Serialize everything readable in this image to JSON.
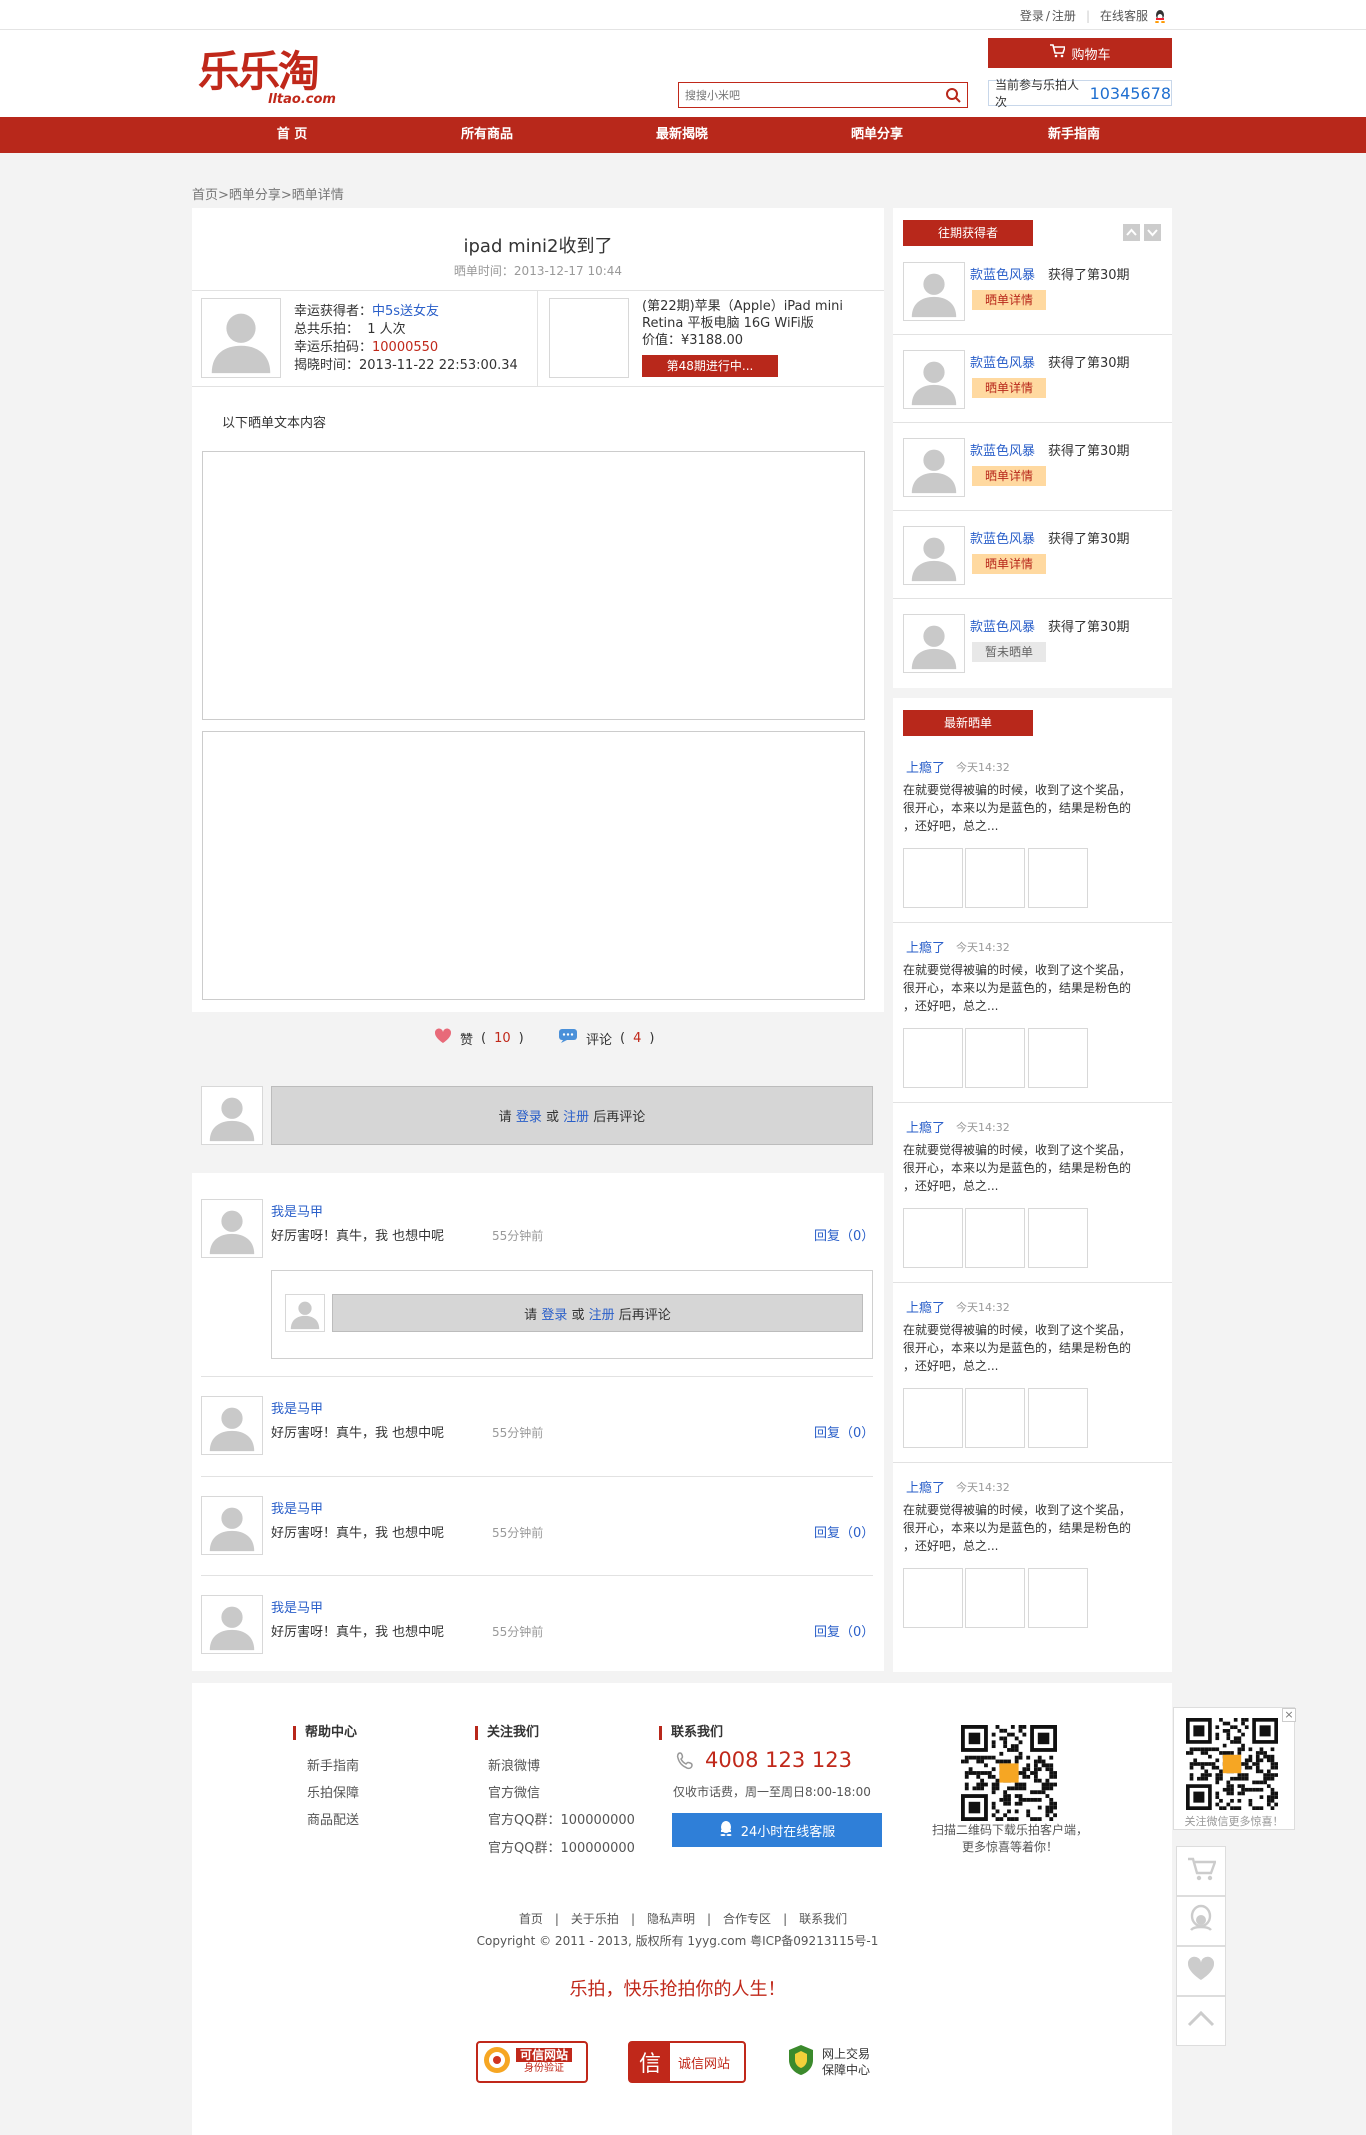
{
  "topbar": {
    "login": "登录",
    "sep": "/",
    "register": "注册",
    "service": "在线客服"
  },
  "header": {
    "logo_cn": "乐乐淘",
    "logo_en": "lltao.com",
    "search_placeholder": "搜搜小米吧",
    "cart_label": "购物车",
    "counter_label": "当前参与乐拍人次",
    "counter_value": "10345678"
  },
  "nav": [
    "首 页",
    "所有商品",
    "最新揭晓",
    "晒单分享",
    "新手指南"
  ],
  "breadcrumb": "首页>晒单分享>晒单详情",
  "post": {
    "title": "ipad mini2收到了",
    "time": "晒单时间：2013-12-17 10:44",
    "winner_label": "幸运获得者：",
    "winner_name": "中5s送女友",
    "total_label": "总共乐拍：",
    "total_value": "1 人次",
    "code_label": "幸运乐拍码：",
    "code_value": "10000550",
    "reveal_label": "揭晓时间：",
    "reveal_value": "2013-11-22 22:53:00.34",
    "product_line1": "(第22期)苹果（Apple）iPad mini",
    "product_line2": "Retina 平板电脑 16G WiFi版",
    "price_label": "价值：",
    "price_value": "¥3188.00",
    "progress_btn": "第48期进行中...",
    "body_text": "以下晒单文本内容",
    "like_label": "赞",
    "like_count": "10",
    "comment_label": "评论",
    "comment_count": "4"
  },
  "comment_prompt": {
    "pre": "请",
    "login": "登录",
    "or": "或",
    "register": "注册",
    "post": "后再评论"
  },
  "comments": [
    {
      "name": "我是马甲",
      "text": "好厉害呀！真牛，我 也想中呢",
      "time": "55分钟前",
      "reply": "回复（0）"
    },
    {
      "name": "我是马甲",
      "text": "好厉害呀！真牛，我 也想中呢",
      "time": "55分钟前",
      "reply": "回复（0）"
    },
    {
      "name": "我是马甲",
      "text": "好厉害呀！真牛，我 也想中呢",
      "time": "55分钟前",
      "reply": "回复（0）"
    },
    {
      "name": "我是马甲",
      "text": "好厉害呀！真牛，我 也想中呢",
      "time": "55分钟前",
      "reply": "回复（0）"
    }
  ],
  "past_winners": {
    "title": "往期获得者",
    "items": [
      {
        "name": "款蓝色风暴",
        "text": "获得了第30期",
        "btn": "晒单详情"
      },
      {
        "name": "款蓝色风暴",
        "text": "获得了第30期",
        "btn": "晒单详情"
      },
      {
        "name": "款蓝色风暴",
        "text": "获得了第30期",
        "btn": "晒单详情"
      },
      {
        "name": "款蓝色风暴",
        "text": "获得了第30期",
        "btn": "晒单详情"
      },
      {
        "name": "款蓝色风暴",
        "text": "获得了第30期",
        "btn": "暂未晒单"
      }
    ]
  },
  "latest_shares": {
    "title": "最新晒单",
    "items": [
      {
        "name": "上瘾了",
        "time": "今天14:32",
        "l1": "在就要觉得被骗的时候，收到了这个奖品，",
        "l2": "很开心，本来以为是蓝色的，结果是粉色的",
        "l3": "，还好吧，总之..."
      },
      {
        "name": "上瘾了",
        "time": "今天14:32",
        "l1": "在就要觉得被骗的时候，收到了这个奖品，",
        "l2": "很开心，本来以为是蓝色的，结果是粉色的",
        "l3": "，还好吧，总之..."
      },
      {
        "name": "上瘾了",
        "time": "今天14:32",
        "l1": "在就要觉得被骗的时候，收到了这个奖品，",
        "l2": "很开心，本来以为是蓝色的，结果是粉色的",
        "l3": "，还好吧，总之..."
      },
      {
        "name": "上瘾了",
        "time": "今天14:32",
        "l1": "在就要觉得被骗的时候，收到了这个奖品，",
        "l2": "很开心，本来以为是蓝色的，结果是粉色的",
        "l3": "，还好吧，总之..."
      },
      {
        "name": "上瘾了",
        "time": "今天14:32",
        "l1": "在就要觉得被骗的时候，收到了这个奖品，",
        "l2": "很开心，本来以为是蓝色的，结果是粉色的",
        "l3": "，还好吧，总之..."
      }
    ]
  },
  "footer": {
    "help": {
      "title": "帮助中心",
      "links": [
        "新手指南",
        "乐拍保障",
        "商品配送"
      ]
    },
    "follow": {
      "title": "关注我们",
      "links": [
        "新浪微博",
        "官方微信",
        "官方QQ群：100000000",
        "官方QQ群：100000000"
      ]
    },
    "contact": {
      "title": "联系我们",
      "phone": "4008 123 123",
      "note": "仅收市话费，周一至周日8:00-18:00",
      "service_btn": "24小时在线客服"
    },
    "qr_note1": "扫描二维码下载乐拍客户端，",
    "qr_note2": "更多惊喜等着你！",
    "bottom_links": [
      "首页",
      "关于乐拍",
      "隐私声明",
      "合作专区",
      "联系我们"
    ],
    "copyright": "Copyright © 2011 - 2013, 版权所有 1yyg.com 粤ICP备09213115号-1",
    "slogan": "乐拍，快乐抢拍你的人生！",
    "badges": [
      "可信网站",
      "身份验证",
      "诚信网站",
      "网上交易",
      "保障中心"
    ],
    "float_qr_note": "关注微信更多惊喜！"
  },
  "colors": {
    "brand": "#b8281b",
    "link": "#2a5fc9"
  }
}
